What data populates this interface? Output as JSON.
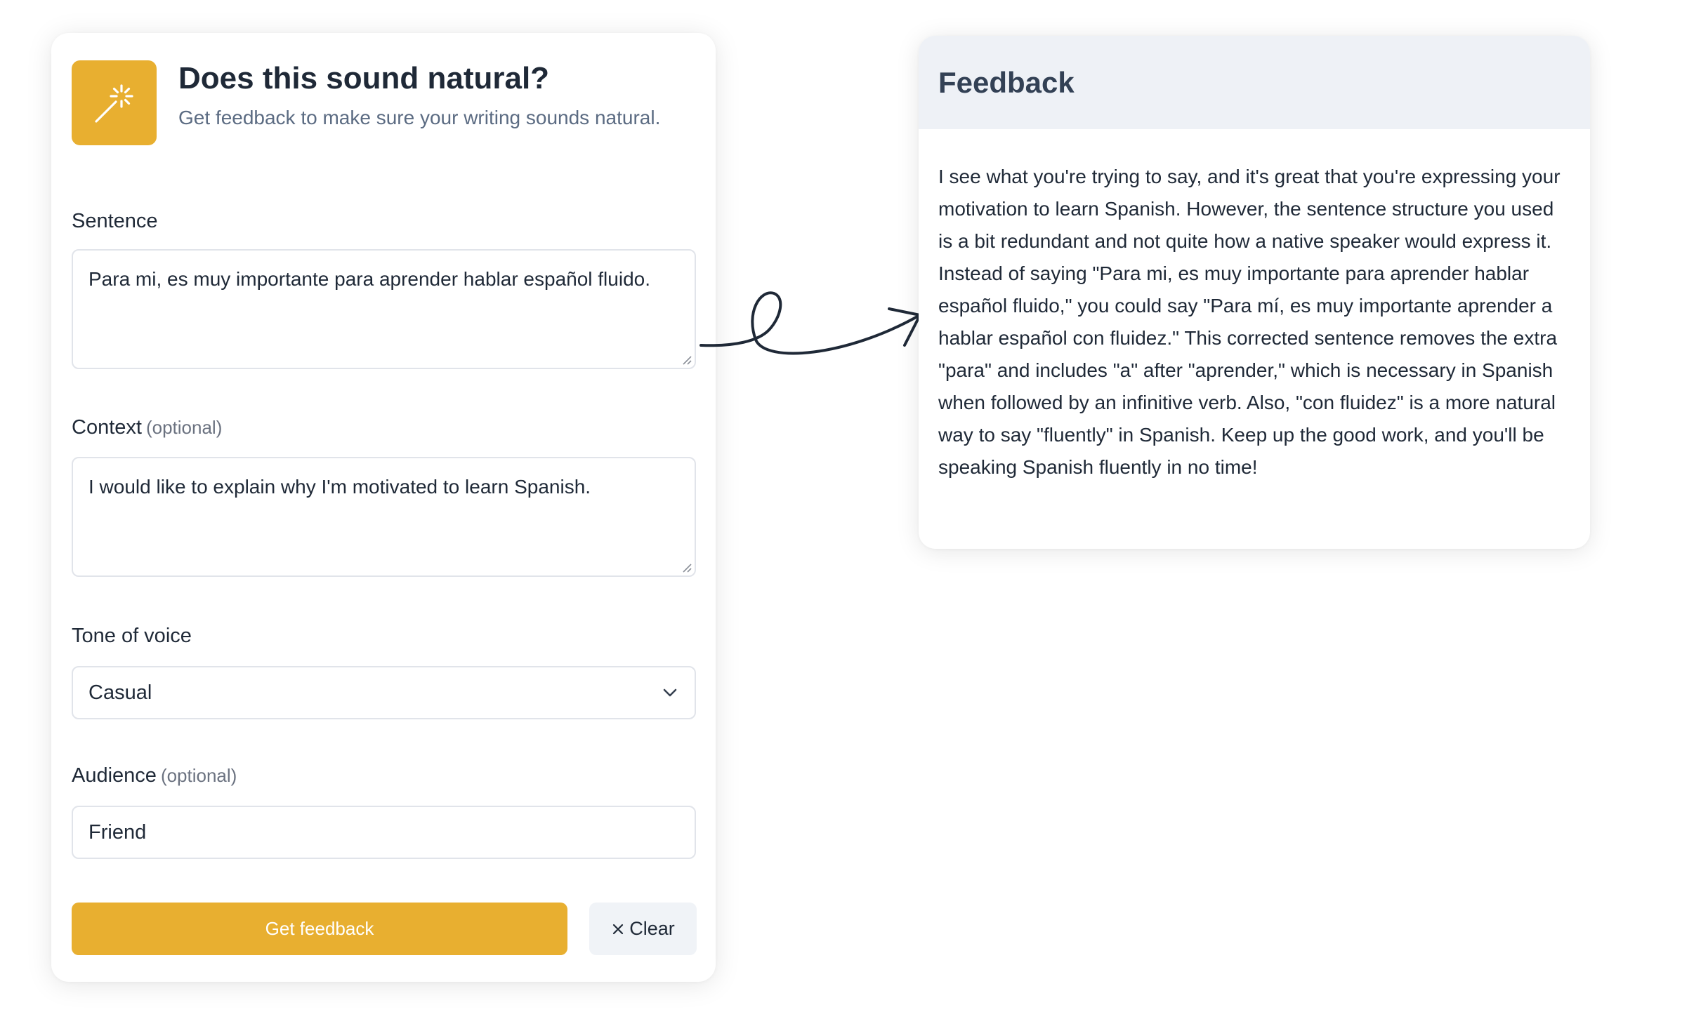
{
  "form": {
    "icon": "magic-wand-icon",
    "title": "Does this sound natural?",
    "subtitle": "Get feedback to make sure your writing sounds natural.",
    "sentence": {
      "label": "Sentence",
      "value": "Para mi, es muy importante para aprender hablar español fluido."
    },
    "context": {
      "label": "Context",
      "optional_tag": "(optional)",
      "value": "I would like to explain why I'm motivated to learn Spanish."
    },
    "tone": {
      "label": "Tone of voice",
      "selected": "Casual",
      "icon": "chevron-down-icon"
    },
    "audience": {
      "label": "Audience",
      "optional_tag": "(optional)",
      "value": "Friend"
    },
    "submit_label": "Get feedback",
    "clear_label": "Clear",
    "clear_icon": "close-icon",
    "accent_color": "#e8af30"
  },
  "connector": {
    "icon": "curly-arrow-icon"
  },
  "feedback": {
    "title": "Feedback",
    "text": "I see what you're trying to say, and it's great that you're expressing your motivation to learn Spanish. However, the sentence structure you used is a bit redundant and not quite how a native speaker would express it. Instead of saying \"Para mi, es muy importante para aprender hablar español fluido,\" you could say \"Para mí, es muy importante aprender a hablar español con fluidez.\" This corrected sentence removes the extra \"para\" and includes \"a\" after \"aprender,\" which is necessary in Spanish when followed by an infinitive verb. Also, \"con fluidez\" is a more natural way to say \"fluently\" in Spanish. Keep up the good work, and you'll be speaking Spanish fluently in no time!"
  }
}
